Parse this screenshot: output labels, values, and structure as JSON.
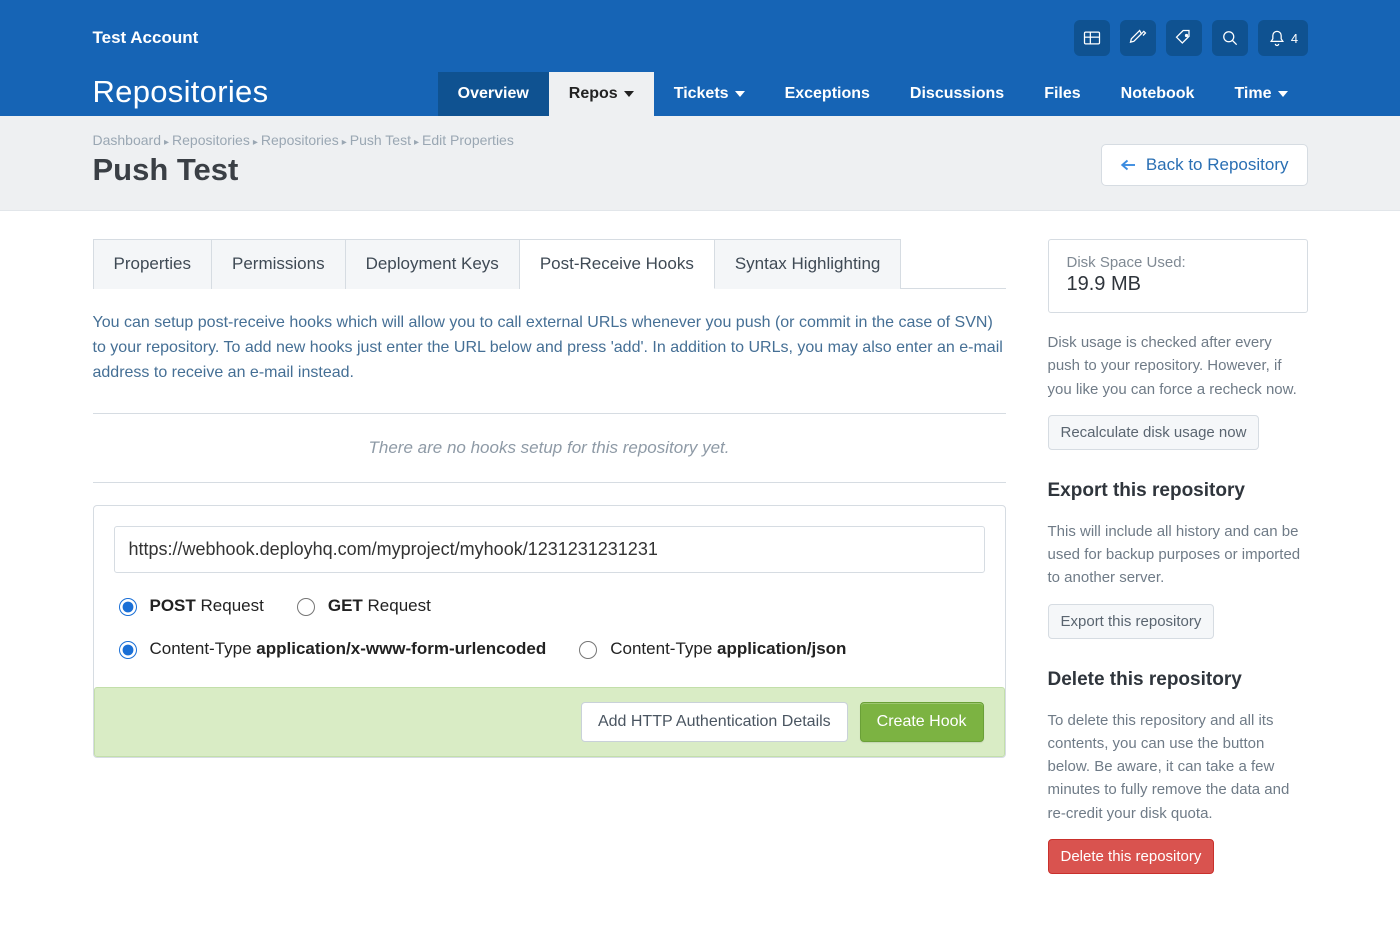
{
  "header": {
    "account_name": "Test Account",
    "section_title": "Repositories",
    "notifications_count": "4",
    "nav": [
      {
        "label": "Overview",
        "dropdown": false,
        "active": false,
        "special": true
      },
      {
        "label": "Repos",
        "dropdown": true,
        "active": true
      },
      {
        "label": "Tickets",
        "dropdown": true,
        "active": false
      },
      {
        "label": "Exceptions",
        "dropdown": false,
        "active": false
      },
      {
        "label": "Discussions",
        "dropdown": false,
        "active": false
      },
      {
        "label": "Files",
        "dropdown": false,
        "active": false
      },
      {
        "label": "Notebook",
        "dropdown": false,
        "active": false
      },
      {
        "label": "Time",
        "dropdown": true,
        "active": false
      }
    ]
  },
  "breadcrumbs": [
    "Dashboard",
    "Repositories",
    "Repositories",
    "Push Test",
    "Edit Properties"
  ],
  "page_title": "Push Test",
  "back_button": "Back to Repository",
  "tabs": [
    {
      "label": "Properties",
      "active": false
    },
    {
      "label": "Permissions",
      "active": false
    },
    {
      "label": "Deployment Keys",
      "active": false
    },
    {
      "label": "Post-Receive Hooks",
      "active": true
    },
    {
      "label": "Syntax Highlighting",
      "active": false
    }
  ],
  "intro_text": "You can setup post-receive hooks which will allow you to call external URLs whenever you push (or commit in the case of SVN) to your repository. To add new hooks just enter the URL below and press 'add'. In addition to URLs, you may also enter an e-mail address to receive an e-mail instead.",
  "empty_text": "There are no hooks setup for this repository yet.",
  "form": {
    "url_value": "https://webhook.deployhq.com/myproject/myhook/1231231231231",
    "method": {
      "post_prefix": "POST",
      "post_suffix": " Request",
      "get_prefix": "GET",
      "get_suffix": " Request"
    },
    "ctype": {
      "form_prefix": "Content-Type ",
      "form_value": "application/x-www-form-urlencoded",
      "json_prefix": "Content-Type ",
      "json_value": "application/json"
    },
    "auth_button": "Add HTTP Authentication Details",
    "create_button": "Create Hook"
  },
  "sidebar": {
    "disk_label": "Disk Space Used:",
    "disk_value": "19.9 MB",
    "disk_note": "Disk usage is checked after every push to your repository. However, if you like you can force a recheck now.",
    "recalc_button": "Recalculate disk usage now",
    "export_heading": "Export this repository",
    "export_note": "This will include all history and can be used for backup purposes or imported to another server.",
    "export_button": "Export this repository",
    "delete_heading": "Delete this repository",
    "delete_note": "To delete this repository and all its contents, you can use the button below. Be aware, it can take a few minutes to fully remove the data and re-credit your disk quota.",
    "delete_button": "Delete this repository"
  }
}
